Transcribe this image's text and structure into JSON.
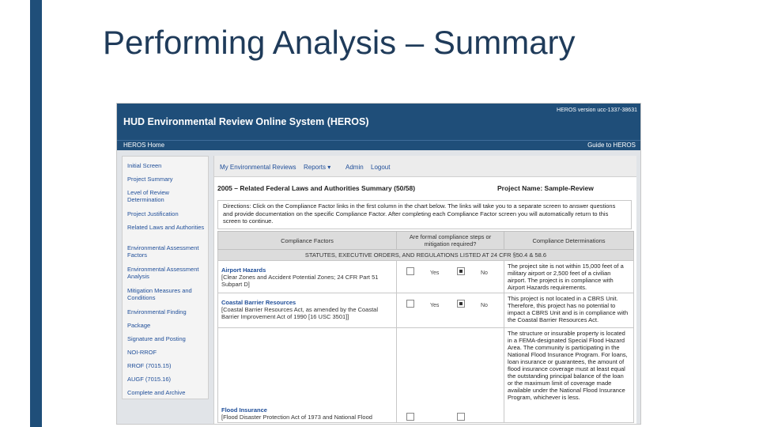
{
  "slide": {
    "title": "Performing Analysis – Summary",
    "accent": "#1f4e79"
  },
  "app": {
    "title": "HUD Environmental Review Online System (HEROS)",
    "version": "HEROS version ucc-1337-38631",
    "home": "HEROS Home",
    "guide": "Guide to HEROS"
  },
  "leftnav": [
    "Initial Screen",
    "Project Summary",
    "Level of Review Determination",
    "Project Justification",
    "Related Laws and Authorities",
    "Environmental Assessment Factors",
    "Environmental Assessment Analysis",
    "Mitigation Measures and Conditions",
    "Environmental Finding",
    "Package",
    "Signature and Posting",
    "NOI-RROF",
    "RROF (7015.15)",
    "AUGF (7015.16)",
    "Complete and Archive"
  ],
  "tabs": {
    "my_reviews": "My Environmental Reviews",
    "reports": "Reports ▾",
    "admin": "Admin",
    "logout": "Logout"
  },
  "summary": {
    "title": "2005 – Related Federal Laws and Authorities Summary (50/58)",
    "project_name": "Project Name: Sample-Review",
    "directions": "Directions: Click on the Compliance Factor links in the first column in the chart below. The links will take you to a separate screen to answer questions and provide documentation on the specific Compliance Factor. After completing each Compliance Factor screen you will automatically return to this screen to continue."
  },
  "table": {
    "headers": [
      "Compliance Factors",
      "Are formal compliance steps or mitigation required?",
      "Compliance Determinations"
    ],
    "section": "STATUTES, EXECUTIVE ORDERS, AND REGULATIONS LISTED AT 24 CFR §50.4 & 58.6",
    "yes": "Yes",
    "no": "No",
    "rows": [
      {
        "name": "Airport Hazards",
        "cite": "[Clear Zones and Accident Potential Zones; 24 CFR Part 51 Subpart D]",
        "yes": false,
        "no": true,
        "determination": "The project site is not within 15,000 feet of a military airport or 2,500 feet of a civilian airport. The project is in compliance with Airport Hazards requirements."
      },
      {
        "name": "Coastal Barrier Resources",
        "cite": "[Coastal Barrier Resources Act, as amended by the Coastal Barrier Improvement Act of 1990 [16 USC 3501]]",
        "yes": false,
        "no": true,
        "determination": "This project is not located in a CBRS Unit. Therefore, this project has no potential to impact a CBRS Unit and is in compliance with the Coastal Barrier Resources Act."
      },
      {
        "name": "Flood Insurance",
        "cite": "[Flood Disaster Protection Act of 1973 and National Flood",
        "yes": false,
        "no": false,
        "determination": "The structure or insurable property is located in a FEMA-designated Special Flood Hazard Area. The community is participating in the National Flood Insurance Program. For loans, loan insurance or guarantees, the amount of flood insurance coverage must at least equal the outstanding principal balance of the loan or the maximum limit of coverage made available under the National Flood Insurance Program, whichever is less."
      }
    ]
  }
}
